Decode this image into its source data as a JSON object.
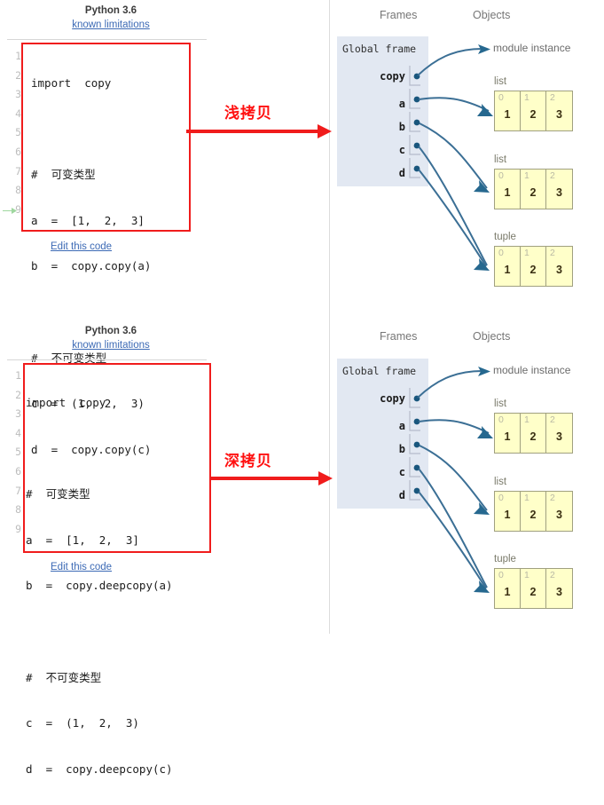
{
  "panels": [
    {
      "id": "shallow",
      "annotation": "浅拷贝",
      "code": {
        "python_version": "Python 3.6",
        "limitations_link": "known limitations",
        "edit_link": "Edit this code",
        "line_numbers": [
          "1",
          "2",
          "3",
          "4",
          "5",
          "6",
          "7",
          "8",
          "9"
        ],
        "lines": [
          "import  copy",
          "",
          "#  可变类型",
          "a  =  [1,  2,  3]",
          "b  =  copy.copy(a)",
          "",
          "#  不可变类型",
          "c  =  (1,  2,  3)",
          "d  =  copy.copy(c)"
        ]
      },
      "viz": {
        "frames_header": "Frames",
        "objects_header": "Objects",
        "frame_title": "Global frame",
        "variables": [
          "copy",
          "a",
          "b",
          "c",
          "d"
        ],
        "module_label": "module instance",
        "objects": [
          {
            "type": "list",
            "indices": [
              "0",
              "1",
              "2"
            ],
            "values": [
              "1",
              "2",
              "3"
            ]
          },
          {
            "type": "list",
            "indices": [
              "0",
              "1",
              "2"
            ],
            "values": [
              "1",
              "2",
              "3"
            ]
          },
          {
            "type": "tuple",
            "indices": [
              "0",
              "1",
              "2"
            ],
            "values": [
              "1",
              "2",
              "3"
            ]
          }
        ]
      }
    },
    {
      "id": "deep",
      "annotation": "深拷贝",
      "code": {
        "python_version": "Python 3.6",
        "limitations_link": "known limitations",
        "edit_link": "Edit this code",
        "line_numbers": [
          "1",
          "2",
          "3",
          "4",
          "5",
          "6",
          "7",
          "8",
          "9"
        ],
        "lines": [
          "import  copy",
          "",
          "#  可变类型",
          "a  =  [1,  2,  3]",
          "b  =  copy.deepcopy(a)",
          "",
          "#  不可变类型",
          "c  =  (1,  2,  3)",
          "d  =  copy.deepcopy(c)"
        ]
      },
      "viz": {
        "frames_header": "Frames",
        "objects_header": "Objects",
        "frame_title": "Global frame",
        "variables": [
          "copy",
          "a",
          "b",
          "c",
          "d"
        ],
        "module_label": "module instance",
        "objects": [
          {
            "type": "list",
            "indices": [
              "0",
              "1",
              "2"
            ],
            "values": [
              "1",
              "2",
              "3"
            ]
          },
          {
            "type": "list",
            "indices": [
              "0",
              "1",
              "2"
            ],
            "values": [
              "1",
              "2",
              "3"
            ]
          },
          {
            "type": "tuple",
            "indices": [
              "0",
              "1",
              "2"
            ],
            "values": [
              "1",
              "2",
              "3"
            ]
          }
        ]
      }
    }
  ],
  "colors": {
    "annotation_red": "#ff1010",
    "box_border_red": "#f01c1c",
    "link_blue": "#3c6ab5",
    "frame_bg": "#e2e8f2",
    "object_bg": "#ffffc9",
    "object_border": "#a0a080",
    "wire_blue": "#3b6f95"
  }
}
